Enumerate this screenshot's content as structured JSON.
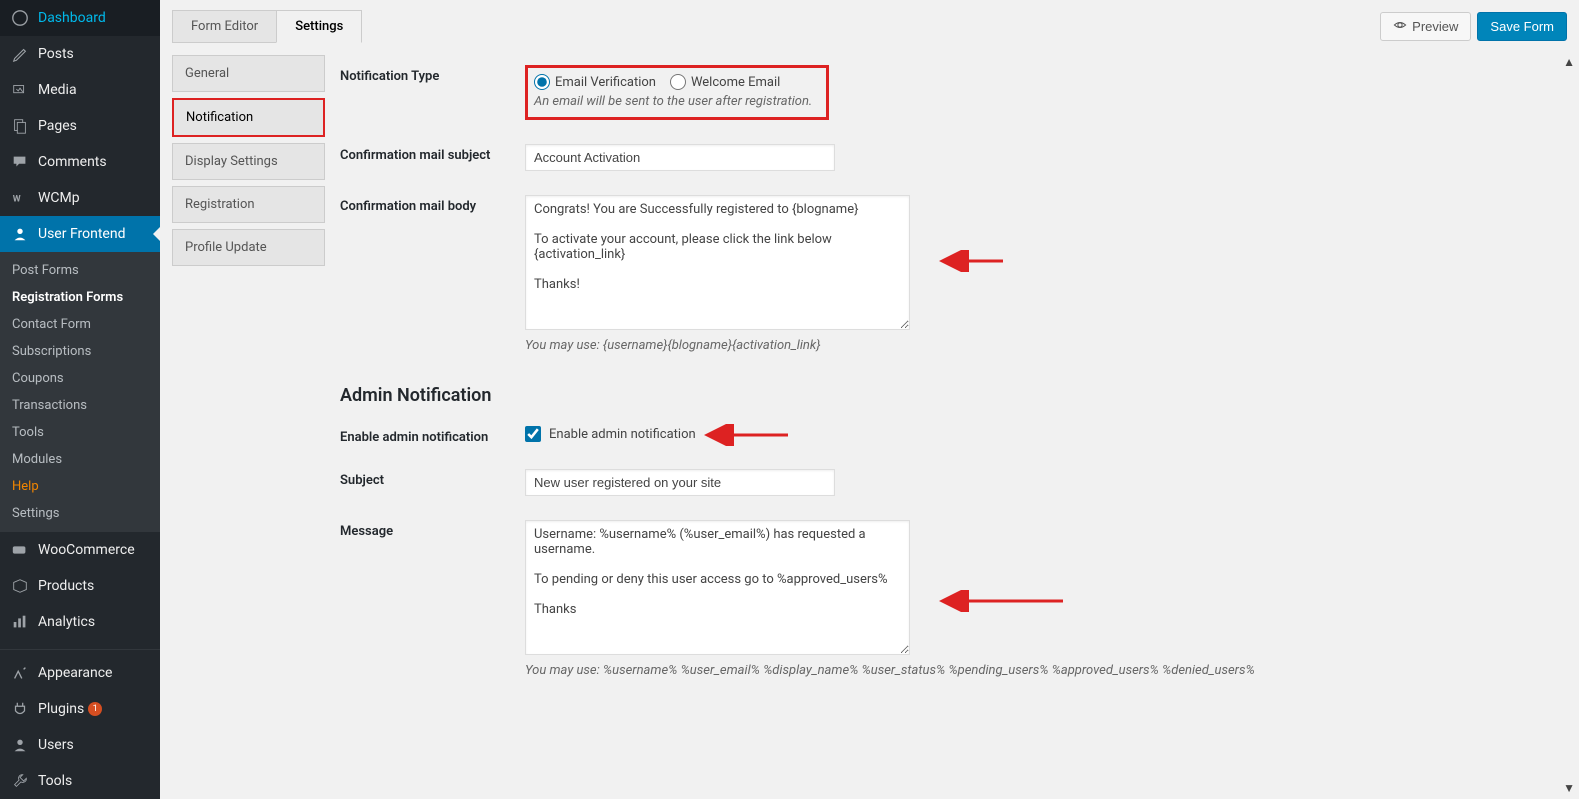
{
  "sidebar": {
    "items": [
      {
        "icon": "dashboard",
        "label": "Dashboard"
      },
      {
        "icon": "posts",
        "label": "Posts"
      },
      {
        "icon": "media",
        "label": "Media"
      },
      {
        "icon": "pages",
        "label": "Pages"
      },
      {
        "icon": "comments",
        "label": "Comments"
      },
      {
        "icon": "wcmp",
        "label": "WCMp"
      },
      {
        "icon": "user-frontend",
        "label": "User Frontend",
        "current": true
      },
      {
        "icon": "woocommerce",
        "label": "WooCommerce"
      },
      {
        "icon": "products",
        "label": "Products"
      },
      {
        "icon": "analytics",
        "label": "Analytics"
      },
      {
        "icon": "appearance",
        "label": "Appearance"
      },
      {
        "icon": "plugins",
        "label": "Plugins",
        "badge": "1"
      },
      {
        "icon": "users",
        "label": "Users"
      },
      {
        "icon": "tools",
        "label": "Tools"
      }
    ],
    "submenu": [
      {
        "label": "Post Forms"
      },
      {
        "label": "Registration Forms",
        "active": true
      },
      {
        "label": "Contact Form"
      },
      {
        "label": "Subscriptions"
      },
      {
        "label": "Coupons"
      },
      {
        "label": "Transactions"
      },
      {
        "label": "Tools"
      },
      {
        "label": "Modules"
      },
      {
        "label": "Help",
        "highlight": true
      },
      {
        "label": "Settings"
      }
    ]
  },
  "topTabs": {
    "formEditor": "Form Editor",
    "settings": "Settings"
  },
  "topButtons": {
    "preview": "Preview",
    "save": "Save Form"
  },
  "sideTabs": [
    {
      "label": "General"
    },
    {
      "label": "Notification",
      "active": true
    },
    {
      "label": "Display Settings"
    },
    {
      "label": "Registration"
    },
    {
      "label": "Profile Update"
    }
  ],
  "form": {
    "notificationType": {
      "label": "Notification Type",
      "emailVerification": "Email Verification",
      "welcomeEmail": "Welcome Email",
      "hint": "An email will be sent to the user after registration."
    },
    "confirmSubject": {
      "label": "Confirmation mail subject",
      "value": "Account Activation"
    },
    "confirmBody": {
      "label": "Confirmation mail body",
      "value": "Congrats! You are Successfully registered to {blogname}\n\nTo activate your account, please click the link below\n{activation_link}\n\nThanks!",
      "hint": "You may use: {username}{blogname}{activation_link}"
    },
    "adminSection": "Admin Notification",
    "enableAdmin": {
      "label": "Enable admin notification",
      "checkboxLabel": "Enable admin notification"
    },
    "subject": {
      "label": "Subject",
      "value": "New user registered on your site"
    },
    "message": {
      "label": "Message",
      "value": "Username: %username% (%user_email%) has requested a username.\n\nTo pending or deny this user access go to %approved_users%\n\nThanks",
      "hint": "You may use: %username% %user_email% %display_name% %user_status% %pending_users% %approved_users% %denied_users%"
    }
  }
}
